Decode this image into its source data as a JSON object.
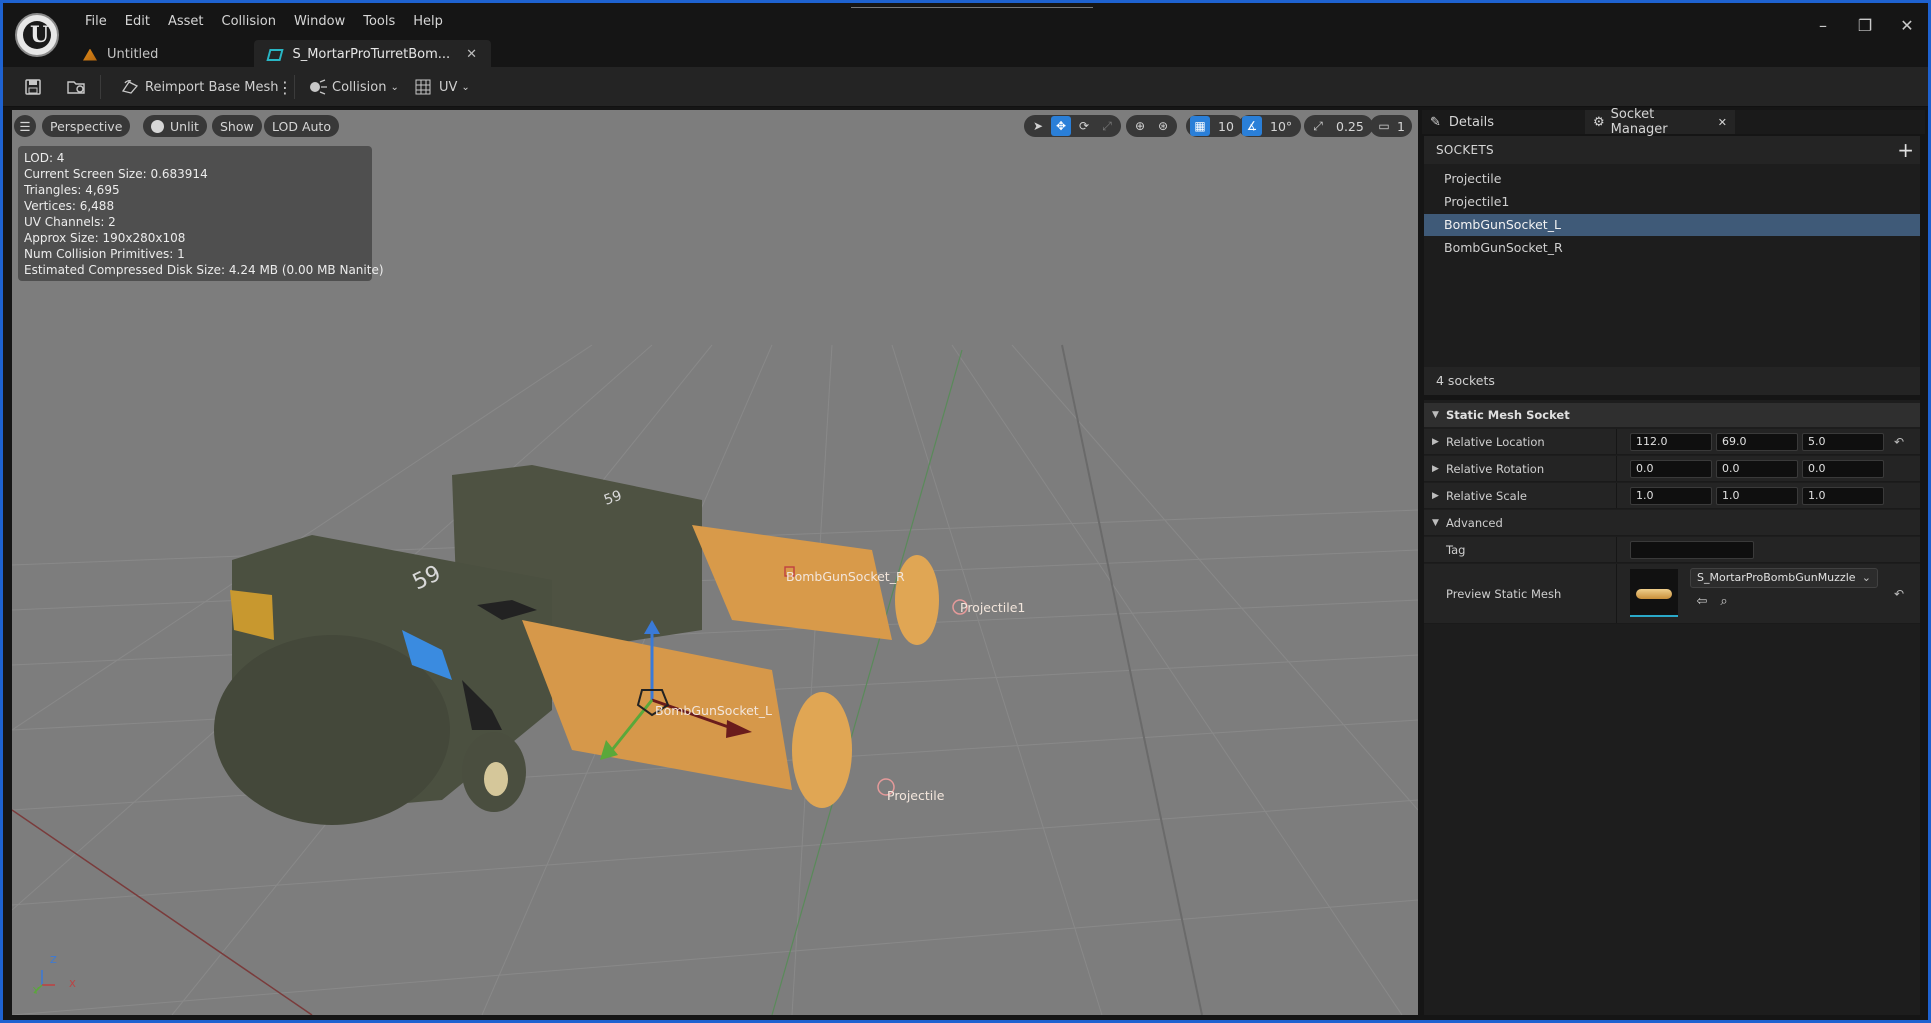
{
  "menu": [
    "File",
    "Edit",
    "Asset",
    "Collision",
    "Window",
    "Tools",
    "Help"
  ],
  "tabs": [
    {
      "label": "Untitled"
    },
    {
      "label": "S_MortarProTurretBom...",
      "close": "✕"
    }
  ],
  "window_controls": {
    "minimize": "–",
    "restore": "❐",
    "close": "✕"
  },
  "toolbar": {
    "reimport_label": "Reimport Base Mesh",
    "collision_label": "Collision",
    "uv_label": "UV"
  },
  "viewport": {
    "perspective_label": "Perspective",
    "unlit_label": "Unlit",
    "show_label": "Show",
    "lod_label": "LOD Auto",
    "grid_snap": "10",
    "rot_snap": "10°",
    "scale_snap": "0.25",
    "camera_speed": "1",
    "stats": [
      "LOD:  4",
      "Current Screen Size:  0.683914",
      "Triangles:  4,695",
      "Vertices:  6,488",
      "UV Channels:  2",
      "Approx Size: 190x280x108",
      "Num Collision Primitives:  1",
      "Estimated Compressed Disk Size: 4.24 MB (0.00 MB Nanite)"
    ],
    "labels": {
      "socket_r": "BombGunSocket_R",
      "socket_l": "BombGunSocket_L",
      "projectile1": "Projectile1",
      "projectile": "Projectile",
      "decal_top": "59",
      "decal_front": "59"
    },
    "axis": {
      "x": "X",
      "y": "Y",
      "z": "Z"
    }
  },
  "panel_tabs": {
    "details": "Details",
    "socket_manager": "Socket Manager",
    "close": "✕"
  },
  "sockets": {
    "header": "SOCKETS",
    "add": "+",
    "items": [
      "Projectile",
      "Projectile1",
      "BombGunSocket_L",
      "BombGunSocket_R"
    ],
    "selected_index": 2,
    "count_text": "4 sockets"
  },
  "details": {
    "section": "Static Mesh Socket",
    "relative_location": {
      "label": "Relative Location",
      "values": [
        "112.0",
        "69.0",
        "5.0"
      ]
    },
    "relative_rotation": {
      "label": "Relative Rotation",
      "values": [
        "0.0",
        "0.0",
        "0.0"
      ]
    },
    "relative_scale": {
      "label": "Relative Scale",
      "values": [
        "1.0",
        "1.0",
        "1.0"
      ]
    },
    "advanced": "Advanced",
    "tag_label": "Tag",
    "tag_value": "",
    "preview_label": "Preview Static Mesh",
    "preview_mesh": "S_MortarProBombGunMuzzle"
  },
  "colors": {
    "accent": "#2a7fd8",
    "selection": "#3f5a78",
    "frame": "#1e62d0"
  }
}
